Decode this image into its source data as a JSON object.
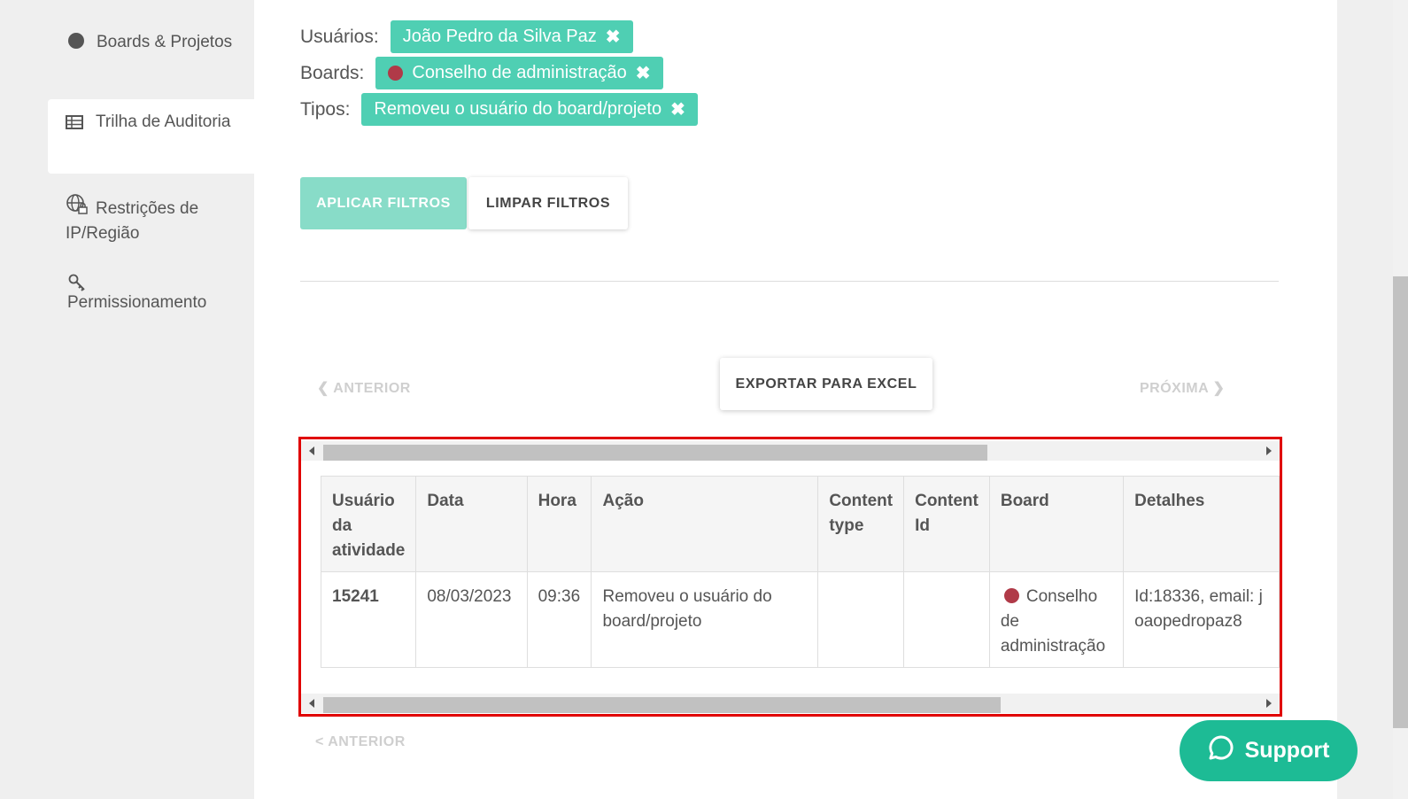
{
  "sidebar": {
    "items": [
      {
        "label": "Boards & Projetos",
        "icon": "circle-icon"
      },
      {
        "label": "Trilha de Auditoria",
        "icon": "table-icon"
      },
      {
        "label": "Restrições de IP/Região",
        "icon": "globe-lock-icon"
      },
      {
        "label": "Permissionamento",
        "icon": "key-icon"
      }
    ]
  },
  "filters": {
    "users_label": "Usuários:",
    "users_chip": "João Pedro da Silva Paz",
    "boards_label": "Boards:",
    "boards_chip": "Conselho de administração",
    "types_label": "Tipos:",
    "types_chip": "Removeu o usuário do board/projeto",
    "remove_glyph": "✖"
  },
  "actions": {
    "apply": "APLICAR FILTROS",
    "clear": "LIMPAR FILTROS",
    "export": "EXPORTAR PARA EXCEL"
  },
  "pager": {
    "prev": "ANTERIOR",
    "next": "PRÓXIMA",
    "prev_bottom": "< ANTERIOR"
  },
  "table": {
    "headers": [
      "Usuário da atividade",
      "Data",
      "Hora",
      "Ação",
      "Content type",
      "Content Id",
      "Board",
      "Detalhes"
    ],
    "rows": [
      {
        "user": "15241",
        "date": "08/03/2023",
        "time": "09:36",
        "action": "Removeu o usuário do board/projeto",
        "content_type": "",
        "content_id": "",
        "board": "Conselho de administração",
        "details": "Id:18336, email: joaopedropaz8"
      }
    ]
  },
  "support": {
    "label": "Support"
  },
  "colors": {
    "chip": "#4fcfb3",
    "apply": "#88dcc8",
    "board_dot": "#b03a48",
    "support": "#1dbb95",
    "highlight": "#e00000"
  }
}
